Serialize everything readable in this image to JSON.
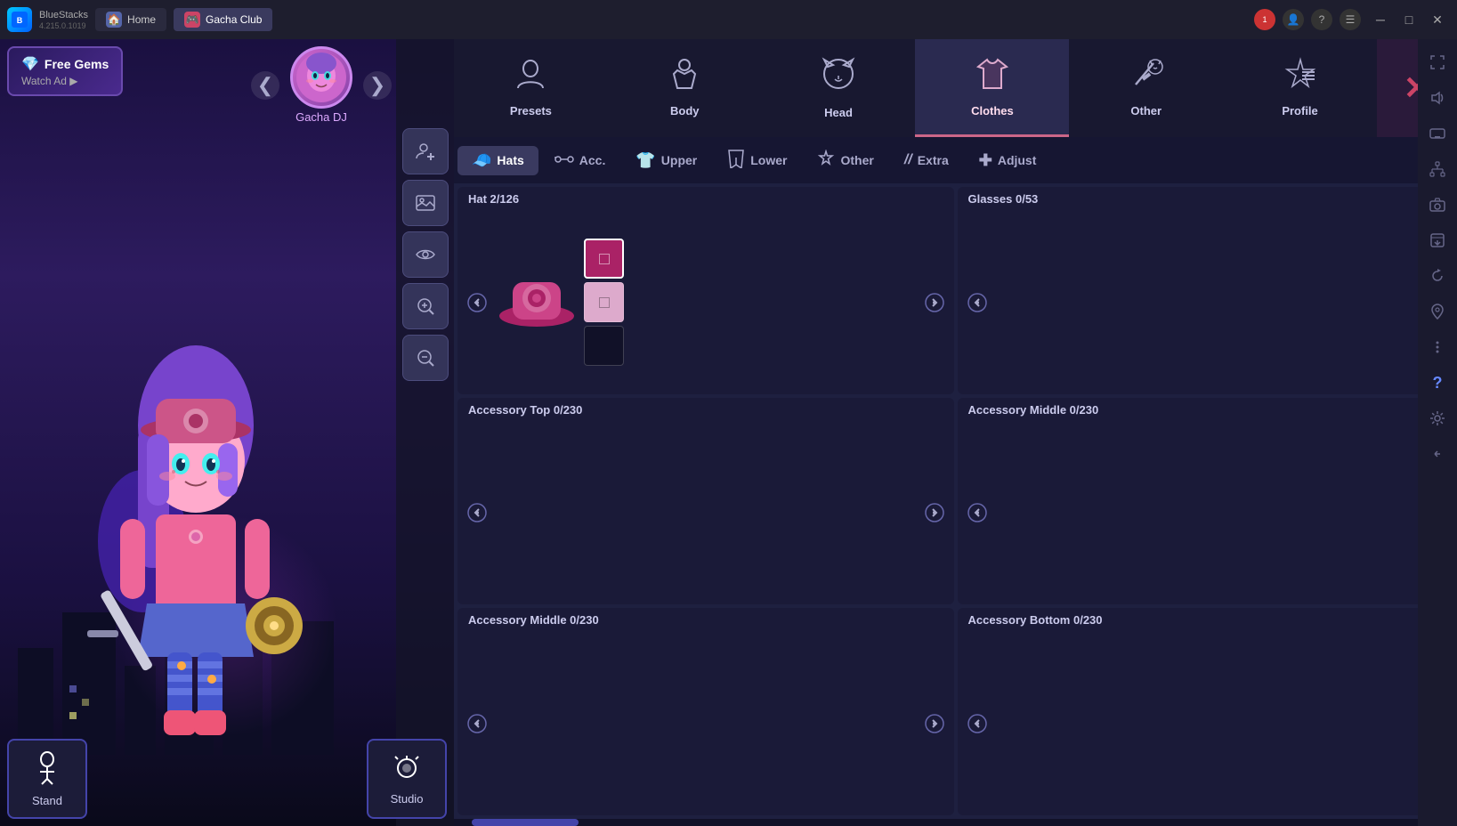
{
  "bluestacks": {
    "version": "4.215.0.1019",
    "tabs": [
      {
        "label": "Home",
        "active": false
      },
      {
        "label": "Gacha Club",
        "active": true
      }
    ],
    "window_controls": [
      "minimize",
      "maximize",
      "close"
    ]
  },
  "left_panel": {
    "free_gems": {
      "label1": "Free Gems",
      "label2": "Watch Ad ▶"
    },
    "character": {
      "name": "Gacha DJ",
      "prev_label": "❮",
      "next_label": "❯"
    },
    "side_buttons": [
      "add-character",
      "image",
      "eye",
      "zoom-in",
      "zoom-out"
    ],
    "stand_btn": "Stand",
    "studio_btn": "Studio"
  },
  "category_tabs": [
    {
      "id": "presets",
      "label": "Presets",
      "icon": "👤"
    },
    {
      "id": "body",
      "label": "Body",
      "icon": "🧥"
    },
    {
      "id": "head",
      "label": "Head",
      "icon": "😺"
    },
    {
      "id": "clothes",
      "label": "Clothes",
      "icon": "👕",
      "active": true
    },
    {
      "id": "other",
      "label": "Other",
      "icon": "⚔️"
    },
    {
      "id": "profile",
      "label": "Profile",
      "icon": "⭐"
    }
  ],
  "sub_tabs": [
    {
      "id": "hats",
      "label": "Hats",
      "icon": "🧢",
      "active": true
    },
    {
      "id": "acc",
      "label": "Acc.",
      "icon": "👓"
    },
    {
      "id": "upper",
      "label": "Upper",
      "icon": "👕"
    },
    {
      "id": "lower",
      "label": "Lower",
      "icon": "👖"
    },
    {
      "id": "other",
      "label": "Other",
      "icon": "🌟"
    },
    {
      "id": "extra",
      "label": "Extra",
      "icon": "//"
    },
    {
      "id": "adjust",
      "label": "Adjust",
      "icon": "✚"
    }
  ],
  "grid_cells": [
    {
      "id": "hat",
      "header": "Hat 2/126",
      "has_item": true,
      "item_type": "hat",
      "colors": [
        "#aa2266",
        "#ddaacc"
      ]
    },
    {
      "id": "glasses",
      "header": "Glasses 0/53",
      "has_item": false
    },
    {
      "id": "accessory_top",
      "header": "Accessory Top 0/230",
      "has_item": false
    },
    {
      "id": "accessory_middle1",
      "header": "Accessory Middle 0/230",
      "has_item": false
    },
    {
      "id": "accessory_middle2",
      "header": "Accessory Middle 0/230",
      "has_item": false
    },
    {
      "id": "accessory_bottom",
      "header": "Accessory Bottom 0/230",
      "has_item": false
    }
  ],
  "bs_side_icons": [
    "fullscreen",
    "volume",
    "keyboard",
    "network",
    "camera",
    "screenshot",
    "rotate",
    "location",
    "more",
    "help",
    "settings",
    "minimize-side"
  ]
}
